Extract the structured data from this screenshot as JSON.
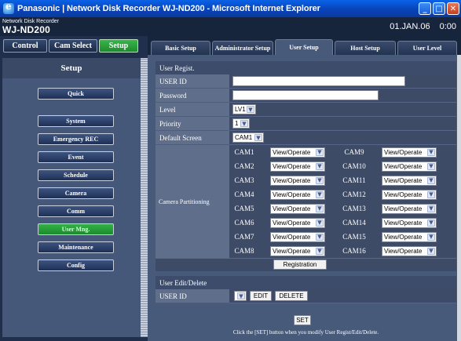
{
  "window": {
    "title": "Panasonic | Network Disk Recorder WJ-ND200 - Microsoft Internet Explorer"
  },
  "header": {
    "product_line": "Network Disk Recorder",
    "product_model": "WJ-ND200",
    "date": "01.JAN.06",
    "time": "0:00"
  },
  "top_tabs": [
    "Control",
    "Cam Select",
    "Setup"
  ],
  "sidebar": {
    "title": "Setup",
    "items": [
      "Quick",
      "System",
      "Emergency REC",
      "Event",
      "Schedule",
      "Camera",
      "Comm",
      "User Mng.",
      "Maintenance",
      "Config"
    ],
    "active": "User Mng."
  },
  "tabs": [
    "Basic Setup",
    "Administrator Setup",
    "User Setup",
    "Host Setup",
    "User Level"
  ],
  "user_regist": {
    "heading": "User Regist.",
    "user_id_label": "USER ID",
    "user_id_value": "",
    "password_label": "Password",
    "password_value": "",
    "level_label": "Level",
    "level_value": "LV1",
    "priority_label": "Priority",
    "priority_value": "1",
    "default_screen_label": "Default Screen",
    "default_screen_value": "CAM1",
    "camera_partitioning_label": "Camera Partitioning",
    "cameras_left": [
      {
        "name": "CAM1",
        "value": "View/Operate"
      },
      {
        "name": "CAM2",
        "value": "View/Operate"
      },
      {
        "name": "CAM3",
        "value": "View/Operate"
      },
      {
        "name": "CAM4",
        "value": "View/Operate"
      },
      {
        "name": "CAM5",
        "value": "View/Operate"
      },
      {
        "name": "CAM6",
        "value": "View/Operate"
      },
      {
        "name": "CAM7",
        "value": "View/Operate"
      },
      {
        "name": "CAM8",
        "value": "View/Operate"
      }
    ],
    "cameras_right": [
      {
        "name": "CAM9",
        "value": "View/Operate"
      },
      {
        "name": "CAM10",
        "value": "View/Operate"
      },
      {
        "name": "CAM11",
        "value": "View/Operate"
      },
      {
        "name": "CAM12",
        "value": "View/Operate"
      },
      {
        "name": "CAM13",
        "value": "View/Operate"
      },
      {
        "name": "CAM14",
        "value": "View/Operate"
      },
      {
        "name": "CAM15",
        "value": "View/Operate"
      },
      {
        "name": "CAM16",
        "value": "View/Operate"
      }
    ],
    "registration_button": "Registration"
  },
  "user_edit": {
    "heading": "User Edit/Delete",
    "user_id_label": "USER ID",
    "user_id_value": "",
    "edit_button": "EDIT",
    "delete_button": "DELETE"
  },
  "set_button": "SET",
  "note": "Click the [SET] button when you modify User Regist/Edit/Delete.",
  "icons": {
    "app": "ie-icon",
    "minimize": "minimize-icon",
    "maximize": "maximize-icon",
    "close": "close-icon",
    "dropdown": "chevron-down-icon"
  },
  "colors": {
    "active_green": "#2aa53c",
    "panel_blue": "#485a7a",
    "header_navy": "#16243c"
  }
}
